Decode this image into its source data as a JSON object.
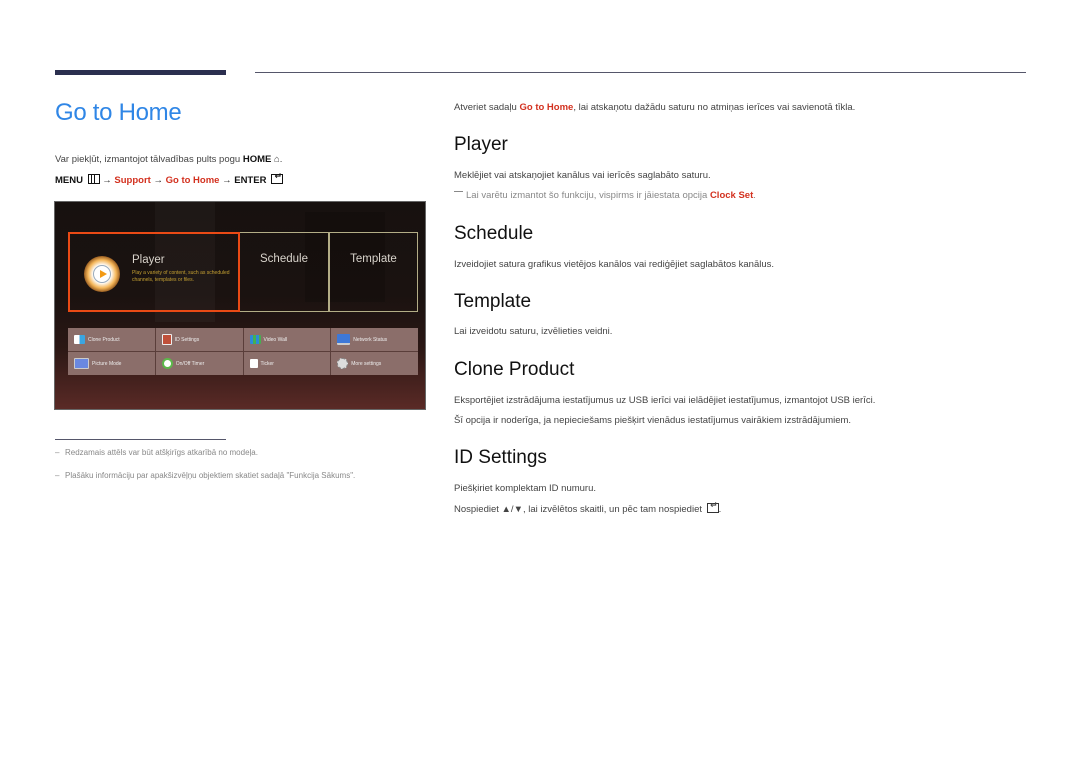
{
  "page": {
    "title": "Go to Home",
    "intro_text": "Var piekļūt, izmantojot tālvadības pults pogu ",
    "intro_button": "HOME",
    "intro_icon": "home-icon",
    "menu_path": {
      "menu": "MENU",
      "arrow": "→",
      "support": "Support",
      "go_to_home": "Go to Home",
      "enter": "ENTER"
    }
  },
  "screen": {
    "tiles": {
      "player": {
        "label": "Player",
        "description": "Play a variety of content, such as scheduled channels, templates or files."
      },
      "schedule": {
        "label": "Schedule"
      },
      "template": {
        "label": "Template"
      }
    },
    "grid": [
      {
        "label": "Clone Product",
        "icon": "clone-product-icon"
      },
      {
        "label": "ID Settings",
        "icon": "id-settings-icon"
      },
      {
        "label": "Video Wall",
        "icon": "video-wall-icon"
      },
      {
        "label": "Network Status",
        "icon": "network-status-icon"
      },
      {
        "label": "Picture Mode",
        "icon": "picture-mode-icon"
      },
      {
        "label": "On/Off Timer",
        "icon": "on-off-timer-icon"
      },
      {
        "label": "Ticker",
        "icon": "ticker-icon"
      },
      {
        "label": "More settings",
        "icon": "more-settings-icon"
      }
    ]
  },
  "footnotes": [
    "Redzamais attēls var būt atšķirīgs atkarībā no modeļa.",
    "Plašāku informāciju par apakšizvēļņu objektiem skatiet sadaļā \"Funkcija Sākums\"."
  ],
  "right": {
    "intro_pre": "Atveriet sadaļu ",
    "intro_link": "Go to Home",
    "intro_post": ", lai atskaņotu dažādu saturu no atmiņas ierīces vai savienotā tīkla.",
    "sections": {
      "player": {
        "heading": "Player",
        "text": "Meklējiet vai atskaņojiet kanālus vai ierīcēs saglabāto saturu.",
        "note_pre": "Lai varētu izmantot šo funkciju, vispirms ir jāiestata opcija ",
        "note_link": "Clock Set",
        "note_post": "."
      },
      "schedule": {
        "heading": "Schedule",
        "text": "Izveidojiet satura grafikus vietējos kanālos vai rediģējiet saglabātos kanālus."
      },
      "template": {
        "heading": "Template",
        "text": "Lai izveidotu saturu, izvēlieties veidni."
      },
      "clone_product": {
        "heading": "Clone Product",
        "text1": "Eksportējiet izstrādājuma iestatījumus uz USB ierīci vai ielādējiet iestatījumus, izmantojot USB ierīci.",
        "text2": "Šī opcija ir noderīga, ja nepieciešams piešķirt vienādus iestatījumus vairākiem izstrādājumiem."
      },
      "id_settings": {
        "heading": "ID Settings",
        "text1": "Piešķiriet komplektam ID numuru.",
        "text2_pre": "Nospiediet ",
        "text2_arrows": "▲/▼",
        "text2_post": ", lai izvēlētos skaitli, un pēc tam nospiediet ",
        "text2_end": "."
      }
    }
  },
  "colors": {
    "title_blue": "#2f86e6",
    "link_red": "#d3311f",
    "focus_orange": "#ea4a15"
  }
}
